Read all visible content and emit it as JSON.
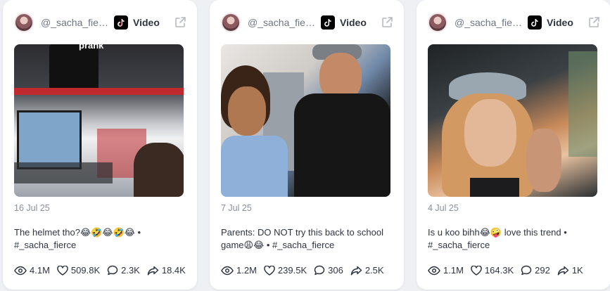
{
  "posts": [
    {
      "handle": "@_sacha_fierce",
      "platform_label": "Video",
      "thumbnail_overlay": "prank",
      "date": "16 Jul 25",
      "caption": "The helmet tho?😂🤣😂🤣😂 • #_sacha_fierce",
      "views": "4.1M",
      "likes": "509.8K",
      "comments": "2.3K",
      "shares": "18.4K"
    },
    {
      "handle": "@_sacha_fierce",
      "platform_label": "Video",
      "thumbnail_overlay": "",
      "date": "7 Jul 25",
      "caption": "Parents: DO NOT try this back to school game😩😂 • #_sacha_fierce",
      "views": "1.2M",
      "likes": "239.5K",
      "comments": "306",
      "shares": "2.5K"
    },
    {
      "handle": "@_sacha_fierce",
      "platform_label": "Video",
      "thumbnail_overlay": "",
      "date": "4 Jul 25",
      "caption": "Is u koo bihh😂🤪 love this trend • #_sacha_fierce",
      "views": "1.1M",
      "likes": "164.3K",
      "comments": "292",
      "shares": "1K"
    }
  ],
  "icons": {
    "platform": "tiktok-icon",
    "external": "external-link-icon",
    "views": "eye-icon",
    "likes": "heart-icon",
    "comments": "comment-icon",
    "shares": "share-icon"
  },
  "colors": {
    "background": "#eef0f4",
    "card": "#ffffff",
    "muted_text": "#8a8f9a",
    "text": "#2f3440"
  }
}
